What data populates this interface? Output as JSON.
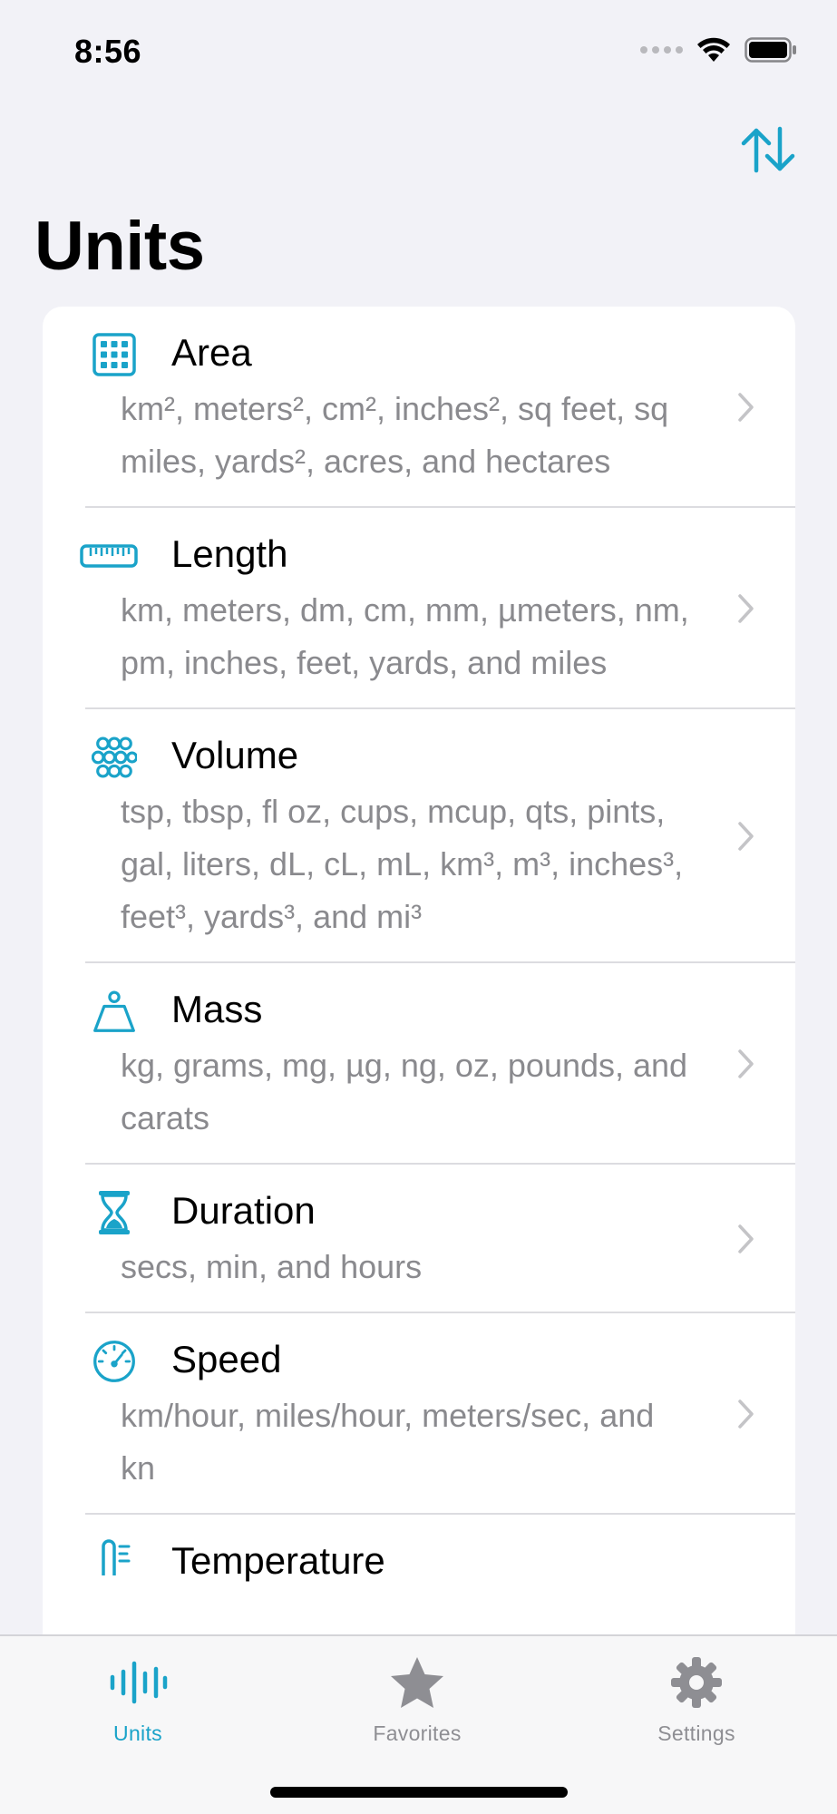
{
  "status_bar": {
    "time": "8:56"
  },
  "nav": {
    "title": "Units",
    "sort_icon": "sort-arrows-icon"
  },
  "colors": {
    "accent": "#1aa3c9",
    "chevron": "#c4c4c7",
    "tab_inactive": "#8e8e93",
    "subtitle": "#8a8a8e"
  },
  "categories": [
    {
      "title": "Area",
      "icon": "grid-icon",
      "units": "km², meters², cm², inches², sq feet, sq miles, yards², acres, and hectares"
    },
    {
      "title": "Length",
      "icon": "ruler-icon",
      "units": "km, meters, dm, cm, mm, µmeters, nm, pm, inches, feet, yards, and miles"
    },
    {
      "title": "Volume",
      "icon": "circles-icon",
      "units": "tsp, tbsp, fl oz, cups, mcup, qts, pints, gal, liters, dL, cL, mL, km³, m³, inches³, feet³, yards³, and mi³"
    },
    {
      "title": "Mass",
      "icon": "scale-weight-icon",
      "units": "kg, grams, mg, µg, ng, oz, pounds, and carats"
    },
    {
      "title": "Duration",
      "icon": "hourglass-icon",
      "units": "secs, min, and hours"
    },
    {
      "title": "Speed",
      "icon": "speedometer-icon",
      "units": "km/hour, miles/hour, meters/sec, and kn"
    },
    {
      "title": "Temperature",
      "icon": "thermometer-icon",
      "units": ""
    }
  ],
  "tabs": [
    {
      "label": "Units",
      "icon": "waveform-icon",
      "selected": true
    },
    {
      "label": "Favorites",
      "icon": "star-icon",
      "selected": false
    },
    {
      "label": "Settings",
      "icon": "gear-icon",
      "selected": false
    }
  ]
}
